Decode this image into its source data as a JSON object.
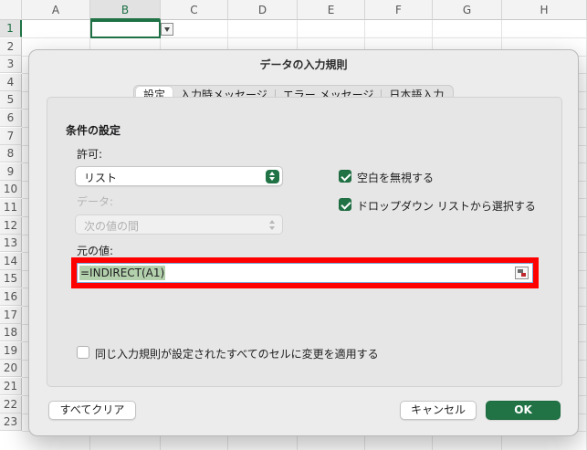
{
  "sheet": {
    "columns": [
      "A",
      "B",
      "C",
      "D",
      "E",
      "F",
      "G",
      "H"
    ],
    "rows": [
      "1",
      "2",
      "3",
      "4",
      "5",
      "6",
      "7",
      "8",
      "9",
      "10",
      "11",
      "12",
      "13",
      "14",
      "15",
      "16",
      "17",
      "18",
      "19",
      "20",
      "21",
      "22",
      "23"
    ],
    "active_column": "B",
    "active_row": "1",
    "accent_color": "#217346"
  },
  "dialog": {
    "title": "データの入力規則",
    "tabs": [
      {
        "label": "設定",
        "active": true
      },
      {
        "label": "入力時メッセージ",
        "active": false
      },
      {
        "label": "エラー メッセージ",
        "active": false
      },
      {
        "label": "日本語入力",
        "active": false
      }
    ],
    "section_title": "条件の設定",
    "allow": {
      "label": "許可:",
      "value": "リスト"
    },
    "data": {
      "label": "データ:",
      "value": "次の値の間",
      "disabled": true
    },
    "ignore_blank": {
      "label": "空白を無視する",
      "checked": true
    },
    "in_cell_dropdown": {
      "label": "ドロップダウン リストから選択する",
      "checked": true
    },
    "source": {
      "label": "元の値:",
      "value": "=INDIRECT(A1)",
      "highlight_color": "#ff0000"
    },
    "apply_all": {
      "label": "同じ入力規則が設定されたすべてのセルに変更を適用する",
      "checked": false
    },
    "buttons": {
      "clear_all": "すべてクリア",
      "cancel": "キャンセル",
      "ok": "OK"
    }
  }
}
